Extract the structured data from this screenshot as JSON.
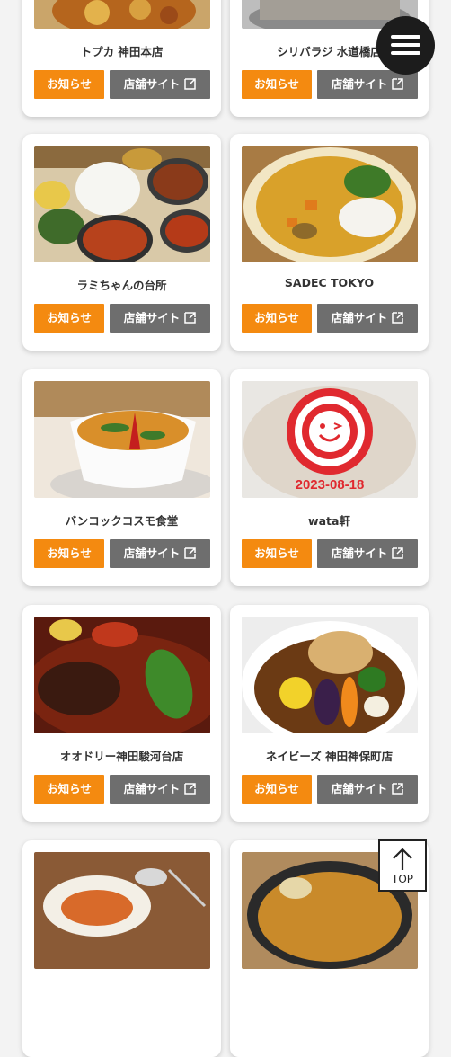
{
  "cards": [
    {
      "name": "トプカ 神田本店",
      "notice_label": "お知らせ",
      "site_label": "店舗サイト"
    },
    {
      "name": "シリバラジ 水道橋店",
      "notice_label": "お知らせ",
      "site_label": "店舗サイト"
    },
    {
      "name": "ラミちゃんの台所",
      "notice_label": "お知らせ",
      "site_label": "店舗サイト"
    },
    {
      "name": "SADEC TOKYO",
      "notice_label": "お知らせ",
      "site_label": "店舗サイト"
    },
    {
      "name": "バンコックコスモ食堂",
      "notice_label": "お知らせ",
      "site_label": "店舗サイト"
    },
    {
      "name": "wata軒",
      "notice_label": "お知らせ",
      "site_label": "店舗サイト",
      "photo_date": "2023-08-18"
    },
    {
      "name": "オオドリー神田駿河台店",
      "notice_label": "お知らせ",
      "site_label": "店舗サイト"
    },
    {
      "name": "ネイビーズ 神田神保町店",
      "notice_label": "お知らせ",
      "site_label": "店舗サイト"
    }
  ],
  "top_button": {
    "label": "TOP"
  },
  "colors": {
    "notice_button": "#f48a10",
    "site_button": "#6e6e6e",
    "menu_button": "#1c1c1c",
    "logo_red": "#e0292f"
  },
  "icons": {
    "menu": "hamburger-menu-icon",
    "external": "external-link-icon",
    "top_arrow": "arrow-up-icon"
  }
}
